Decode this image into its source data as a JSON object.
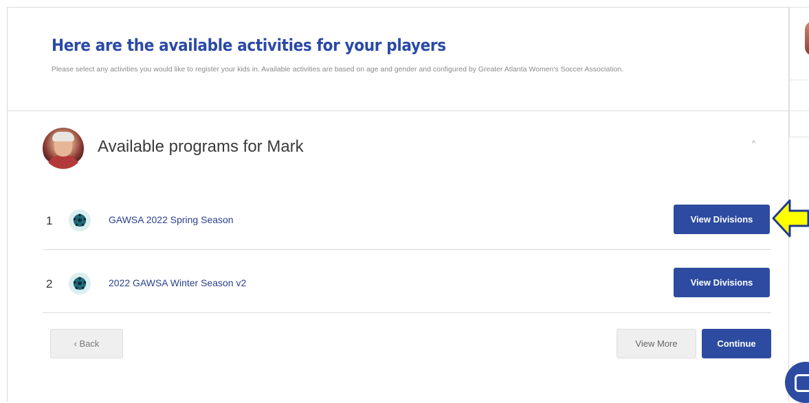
{
  "header": {
    "title": "Here are the available activities for your players",
    "subtitle": "Please select any activities you would like to register your kids in. Available activities are based on age and gender and configured by Greater Atlanta Women's Soccer Association."
  },
  "section": {
    "title": "Available programs for Mark",
    "collapse_glyph": "^"
  },
  "programs": [
    {
      "number": "1",
      "name": "GAWSA 2022 Spring Season",
      "button": "View Divisions"
    },
    {
      "number": "2",
      "name": "2022 GAWSA Winter Season v2",
      "button": "View Divisions"
    }
  ],
  "footer": {
    "back_label": "‹ Back",
    "view_more_label": "View More",
    "continue_label": "Continue"
  },
  "colors": {
    "primary": "#2d4ba0",
    "title": "#2b4aa6",
    "arrow": "#ffff00"
  },
  "icons": {
    "program": "soccer-ball-icon",
    "annotation": "yellow-arrow-icon"
  }
}
